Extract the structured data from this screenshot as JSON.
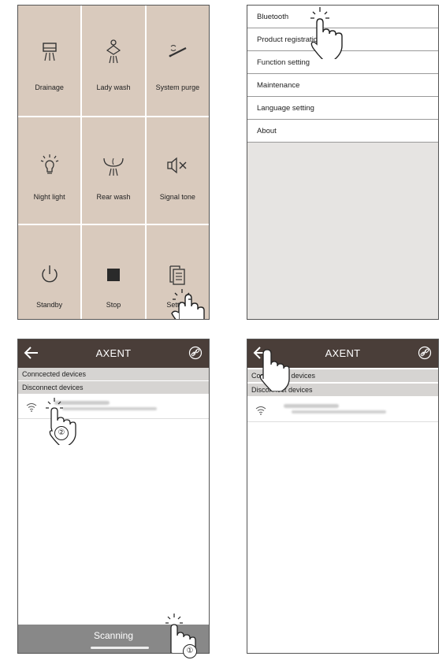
{
  "panel1": {
    "cells": [
      {
        "label": "Drainage",
        "icon": "drainage-icon"
      },
      {
        "label": "Lady wash",
        "icon": "lady-wash-icon"
      },
      {
        "label": "System purge",
        "icon": "system-purge-icon"
      },
      {
        "label": "Night light",
        "icon": "night-light-icon"
      },
      {
        "label": "Rear wash",
        "icon": "rear-wash-icon"
      },
      {
        "label": "Signal tone",
        "icon": "signal-tone-icon"
      },
      {
        "label": "Standby",
        "icon": "standby-icon"
      },
      {
        "label": "Stop",
        "icon": "stop-icon"
      },
      {
        "label": "Setting",
        "icon": "setting-icon"
      }
    ],
    "cell_color": "#d9cabd"
  },
  "panel2": {
    "menu": [
      {
        "label": "Bluetooth"
      },
      {
        "label": "Product registration"
      },
      {
        "label": "Function setting"
      },
      {
        "label": "Maintenance"
      },
      {
        "label": "Language setting"
      },
      {
        "label": "About"
      }
    ]
  },
  "panel3": {
    "title": "AXENT",
    "connected_label": "Conncected devices",
    "disconnect_label": "Disconnect devices",
    "scan_label": "Scanning",
    "step_tap_device": "②",
    "step_scan": "①"
  },
  "panel4": {
    "title": "AXENT",
    "connected_label": "Conncected devices",
    "disconnect_label": "Disconnect devices"
  },
  "colors": {
    "appbar": "#4a3e39",
    "cell": "#d9cabd",
    "section": "#d6d4d2",
    "scanbar": "#888888"
  }
}
